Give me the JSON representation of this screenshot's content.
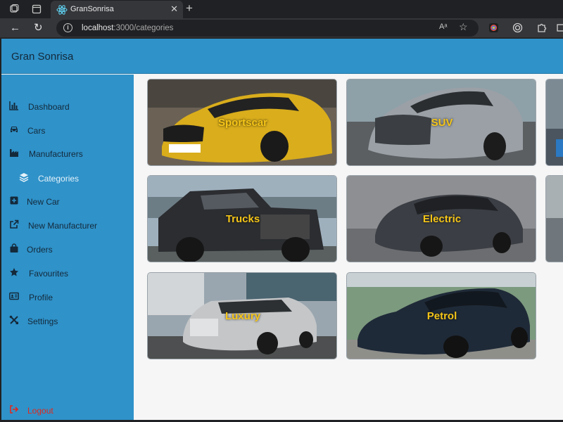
{
  "browser": {
    "tab_title": "GranSonrisa",
    "tab_close": "✕",
    "new_tab": "+",
    "url_host": "localhost",
    "url_path": ":3000/categories",
    "info_icon": "i",
    "read_aloud": "Aᵃ",
    "favorite_icon": "☆",
    "back_icon": "←",
    "reload_icon": "↻"
  },
  "app": {
    "brand": "Gran Sonrisa"
  },
  "sidebar": {
    "items": [
      {
        "label": "Dashboard",
        "icon": "chart-bar-icon"
      },
      {
        "label": "Cars",
        "icon": "car-icon"
      },
      {
        "label": "Manufacturers",
        "icon": "industry-icon"
      },
      {
        "label": "Categories",
        "icon": "layers-icon"
      },
      {
        "label": "New Car",
        "icon": "plus-square-icon"
      },
      {
        "label": "New Manufacturer",
        "icon": "external-link-icon"
      },
      {
        "label": "Orders",
        "icon": "shopping-bag-icon"
      },
      {
        "label": "Favourites",
        "icon": "star-icon"
      },
      {
        "label": "Profile",
        "icon": "id-card-icon"
      },
      {
        "label": "Settings",
        "icon": "tools-icon"
      }
    ],
    "active": "Categories",
    "logout": {
      "label": "Logout",
      "icon": "sign-out-icon"
    }
  },
  "categories": [
    {
      "label": "Sportscar",
      "car_color": "#d9ad1c"
    },
    {
      "label": "SUV",
      "car_color": "#9aa0a6"
    },
    {
      "label": "Trucks",
      "car_color": "#2b2d30"
    },
    {
      "label": "Electric",
      "car_color": "#3b3e44"
    },
    {
      "label": "Luxury",
      "car_color": "#c4c6c8"
    },
    {
      "label": "Petrol",
      "car_color": "#1f2a38"
    }
  ],
  "colors": {
    "header": "#2f92c9",
    "sidebar": "#2f92c9",
    "active_text": "#e6f2fa",
    "logout_text": "#e0291d",
    "card_label": "#f5c518"
  }
}
